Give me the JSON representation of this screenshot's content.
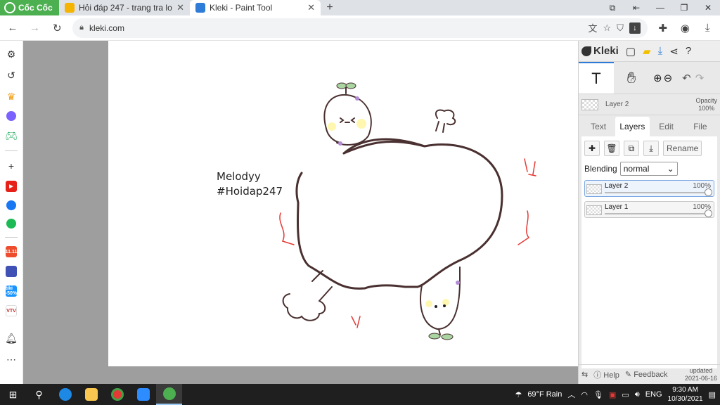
{
  "browser": {
    "brand": "Cốc Cốc",
    "tabs": [
      {
        "title": "Hỏi đáp 247 - trang tra loi",
        "active": false
      },
      {
        "title": "Kleki - Paint Tool",
        "active": true
      }
    ],
    "url": "kleki.com",
    "sidebar_icons": [
      "gear-icon",
      "history-icon",
      "crown-icon",
      "messenger-icon",
      "game-icon",
      "add-icon",
      "youtube-icon",
      "facebook-icon",
      "spotify-icon",
      "shopee-icon",
      "game-app-icon",
      "tiki-icon",
      "vtv-icon",
      "bell-icon",
      "more-icon"
    ],
    "sidebar_badges": {
      "shopee": "11.11",
      "tiki": "tiki -50%",
      "vtv": "VTV"
    }
  },
  "drawing": {
    "text_line1": "Melodyy",
    "text_line2": "#Hoidap247"
  },
  "kleki": {
    "logo": "Kleki",
    "active_layer": "Layer 2",
    "opacity_label": "Opacity",
    "opacity_value": "100%",
    "tabs": [
      "Text",
      "Layers",
      "Edit",
      "File"
    ],
    "active_tab": "Layers",
    "rename_label": "Rename",
    "blending_label": "Blending",
    "blending_value": "normal",
    "layers": [
      {
        "name": "Layer 2",
        "opacity": "100%",
        "selected": true
      },
      {
        "name": "Layer 1",
        "opacity": "100%",
        "selected": false
      }
    ],
    "help_label": "Help",
    "feedback_label": "Feedback",
    "updated_label": "updated",
    "updated_date": "2021-06-16"
  },
  "taskbar": {
    "weather": "69°F  Rain",
    "language": "ENG",
    "time": "9:30 AM",
    "date": "10/30/2021"
  },
  "colors": {
    "brand_green": "#4caf50",
    "stroke": "#4a3030",
    "accent_red": "#e53935",
    "kleki_blue": "#2f7bd8"
  }
}
